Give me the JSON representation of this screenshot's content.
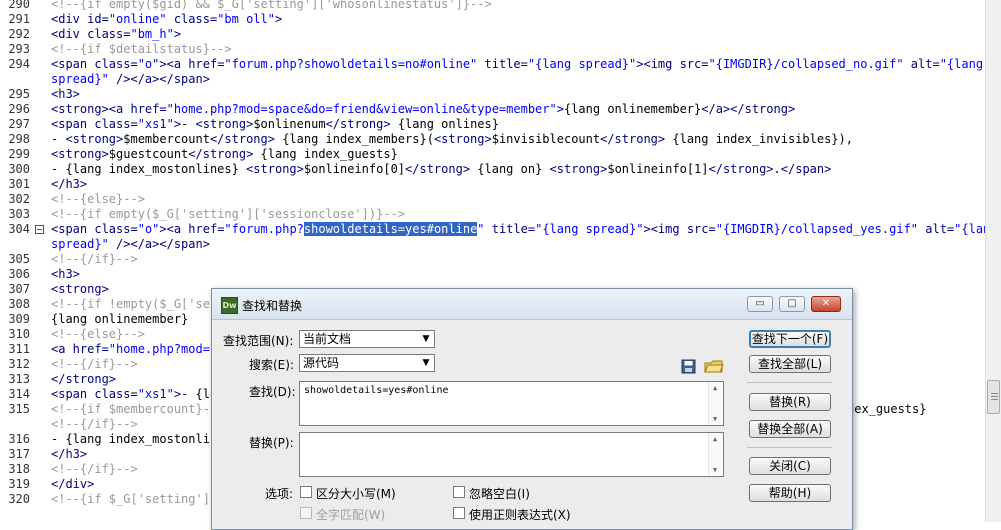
{
  "editor": {
    "lines": [
      {
        "num": "290",
        "segs": [
          [
            "c",
            "<!--{if empty($gid) && $_G['setting']['whosonlinestatus']}-->"
          ]
        ]
      },
      {
        "num": "291",
        "segs": [
          [
            "t",
            "<div "
          ],
          [
            "t",
            "id="
          ],
          [
            "v",
            "\"online\""
          ],
          [
            "t",
            " class="
          ],
          [
            "v",
            "\"bm oll\""
          ],
          [
            "t",
            ">"
          ]
        ]
      },
      {
        "num": "292",
        "segs": [
          [
            "t",
            "<div class="
          ],
          [
            "v",
            "\"bm_h\""
          ],
          [
            "t",
            ">"
          ]
        ]
      },
      {
        "num": "293",
        "segs": [
          [
            "c",
            "<!--{if $detailstatus}-->"
          ]
        ]
      },
      {
        "num": "294",
        "segs": [
          [
            "t",
            "<span class="
          ],
          [
            "v",
            "\"o\""
          ],
          [
            "t",
            "><a href="
          ],
          [
            "v",
            "\"forum.php?showoldetails=no#online\""
          ],
          [
            "t",
            " title="
          ],
          [
            "v",
            "\"{lang spread}\""
          ],
          [
            "t",
            "><img src="
          ],
          [
            "v",
            "\"{IMGDIR}/collapsed_no.gif\""
          ],
          [
            "t",
            " alt="
          ],
          [
            "v",
            "\"{lang"
          ]
        ]
      },
      {
        "num": "",
        "segs": [
          [
            "v",
            "spread}\""
          ],
          [
            "t",
            " /></a></span>"
          ]
        ]
      },
      {
        "num": "295",
        "segs": [
          [
            "t",
            "<h3>"
          ]
        ]
      },
      {
        "num": "296",
        "segs": [
          [
            "t",
            "<strong><a href="
          ],
          [
            "v",
            "\"home.php?mod=space&do=friend&view=online&type=member\""
          ],
          [
            "t",
            ">"
          ],
          [
            "x",
            "{lang onlinemember}"
          ],
          [
            "t",
            "</a></strong>"
          ]
        ]
      },
      {
        "num": "297",
        "segs": [
          [
            "t",
            "<span class="
          ],
          [
            "v",
            "\"xs1\""
          ],
          [
            "t",
            ">"
          ],
          [
            "x",
            "- "
          ],
          [
            "t",
            "<strong>"
          ],
          [
            "x",
            "$onlinenum"
          ],
          [
            "t",
            "</strong>"
          ],
          [
            "x",
            " {lang onlines}"
          ]
        ]
      },
      {
        "num": "298",
        "segs": [
          [
            "x",
            "- "
          ],
          [
            "t",
            "<strong>"
          ],
          [
            "x",
            "$membercount"
          ],
          [
            "t",
            "</strong>"
          ],
          [
            "x",
            " {lang index_members}("
          ],
          [
            "t",
            "<strong>"
          ],
          [
            "x",
            "$invisiblecount"
          ],
          [
            "t",
            "</strong>"
          ],
          [
            "x",
            " {lang index_invisibles}),"
          ]
        ]
      },
      {
        "num": "299",
        "segs": [
          [
            "t",
            "<strong>"
          ],
          [
            "x",
            "$guestcount"
          ],
          [
            "t",
            "</strong>"
          ],
          [
            "x",
            " {lang index_guests}"
          ]
        ]
      },
      {
        "num": "300",
        "segs": [
          [
            "x",
            "- {lang index_mostonlines} "
          ],
          [
            "t",
            "<strong>"
          ],
          [
            "x",
            "$onlineinfo[0]"
          ],
          [
            "t",
            "</strong>"
          ],
          [
            "x",
            " {lang on} "
          ],
          [
            "t",
            "<strong>"
          ],
          [
            "x",
            "$onlineinfo[1]"
          ],
          [
            "t",
            "</strong>"
          ],
          [
            "x",
            "."
          ],
          [
            "t",
            "</span>"
          ]
        ]
      },
      {
        "num": "301",
        "segs": [
          [
            "t",
            "</h3>"
          ]
        ]
      },
      {
        "num": "302",
        "segs": [
          [
            "c",
            "<!--{else}-->"
          ]
        ]
      },
      {
        "num": "303",
        "segs": [
          [
            "c",
            "<!--{if empty($_G['setting']['sessionclose'])}-->"
          ]
        ]
      },
      {
        "num": "304",
        "fold": true,
        "segs": [
          [
            "t",
            "<span class="
          ],
          [
            "v",
            "\"o\""
          ],
          [
            "t",
            "><a href="
          ],
          [
            "v",
            "\"forum.php?"
          ],
          [
            "sel",
            "showoldetails=yes#online"
          ],
          [
            "v",
            "\""
          ],
          [
            "t",
            " title="
          ],
          [
            "v",
            "\"{lang spread}\""
          ],
          [
            "t",
            "><img src="
          ],
          [
            "v",
            "\"{IMGDIR}/collapsed_yes.gif\""
          ],
          [
            "t",
            " alt="
          ],
          [
            "v",
            "\"{lang"
          ]
        ]
      },
      {
        "num": "",
        "segs": [
          [
            "v",
            "spread}\""
          ],
          [
            "t",
            " /></a></span>"
          ]
        ]
      },
      {
        "num": "305",
        "segs": [
          [
            "c",
            "<!--{/if}-->"
          ]
        ]
      },
      {
        "num": "306",
        "segs": [
          [
            "t",
            "<h3>"
          ]
        ]
      },
      {
        "num": "307",
        "segs": [
          [
            "t",
            "<strong>"
          ]
        ]
      },
      {
        "num": "308",
        "segs": [
          [
            "c",
            "<!--{if !empty($_G['set"
          ]
        ]
      },
      {
        "num": "309",
        "segs": [
          [
            "x",
            "{lang onlinemember}"
          ]
        ]
      },
      {
        "num": "310",
        "segs": [
          [
            "c",
            "<!--{else}-->"
          ]
        ]
      },
      {
        "num": "311",
        "segs": [
          [
            "t",
            "<a href="
          ],
          [
            "v",
            "\"home.php?mod=s"
          ]
        ]
      },
      {
        "num": "312",
        "segs": [
          [
            "c",
            "<!--{/if}-->"
          ]
        ]
      },
      {
        "num": "313",
        "segs": [
          [
            "t",
            "</strong>"
          ]
        ]
      },
      {
        "num": "314",
        "segs": [
          [
            "t",
            "<span class="
          ],
          [
            "v",
            "\"xs1\""
          ],
          [
            "t",
            ">"
          ],
          [
            "x",
            "- {la"
          ]
        ]
      },
      {
        "num": "315",
        "segs": [
          [
            "c",
            "<!--{if $membercount}--"
          ]
        ],
        "tail": "dex_guests}"
      },
      {
        "num": "",
        "segs": [
          [
            "c",
            "<!--{/if}-->"
          ]
        ]
      },
      {
        "num": "316",
        "segs": [
          [
            "x",
            "- {lang index_mostonlin"
          ]
        ]
      },
      {
        "num": "317",
        "segs": [
          [
            "t",
            "</h3>"
          ]
        ]
      },
      {
        "num": "318",
        "segs": [
          [
            "c",
            "<!--{/if}-->"
          ]
        ]
      },
      {
        "num": "319",
        "segs": [
          [
            "t",
            "</div>"
          ]
        ]
      },
      {
        "num": "320",
        "segs": [
          [
            "c",
            "<!--{if $_G['setting']["
          ]
        ]
      }
    ]
  },
  "dialog": {
    "app_icon": "Dw",
    "title": "查找和替换",
    "find_in_label": "查找范围(N):",
    "find_in_value": "当前文档",
    "search_label": "搜索(E):",
    "search_value": "源代码",
    "find_label": "查找(D):",
    "find_value": "showoldetails=yes#online",
    "replace_label": "替换(P):",
    "replace_value": "",
    "options_label": "选项:",
    "opt_match_case": "区分大小写(M)",
    "opt_ignore_whitespace": "忽略空白(I)",
    "opt_whole_word": "全字匹配(W)",
    "opt_regex": "使用正则表达式(X)",
    "btn_find_next": "查找下一个(F)",
    "btn_find_all": "查找全部(L)",
    "btn_replace": "替换(R)",
    "btn_replace_all": "替换全部(A)",
    "btn_close": "关闭(C)",
    "btn_help": "帮助(H)",
    "win_min": "▭",
    "win_max": "▢",
    "win_close": "✕"
  }
}
